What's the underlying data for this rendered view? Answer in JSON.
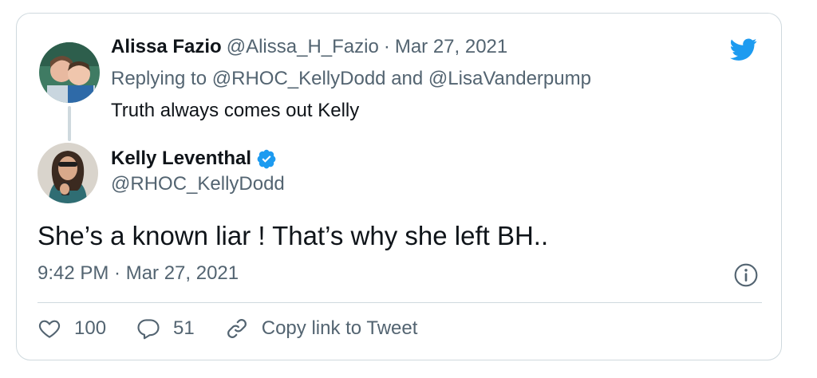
{
  "original_tweet": {
    "author_name": "Alissa Fazio",
    "handle": "@Alissa_H_Fazio",
    "separator": "·",
    "date": "Mar 27, 2021",
    "replying_prefix": "Replying to",
    "reply_to_1": "@RHOC_KellyDodd",
    "reply_joiner": "and",
    "reply_to_2": "@LisaVanderpump",
    "text": "Truth always comes out Kelly"
  },
  "reply_tweet": {
    "author_name": "Kelly Leventhal",
    "handle": "@RHOC_KellyDodd",
    "text": "She’s a known liar ! That’s why she left BH..",
    "timestamp": "9:42 PM · Mar 27, 2021"
  },
  "actions": {
    "likes": "100",
    "replies": "51",
    "copy_link": "Copy link to Tweet"
  },
  "icons": {
    "brand": "twitter-bird-icon",
    "verified": "verified-badge-icon",
    "info": "info-icon",
    "like": "heart-icon",
    "reply": "reply-bubble-icon",
    "link": "link-icon"
  },
  "colors": {
    "brand_blue": "#1d9bf0",
    "text": "#0f1419",
    "muted": "#536471",
    "border": "#cfd9de"
  }
}
